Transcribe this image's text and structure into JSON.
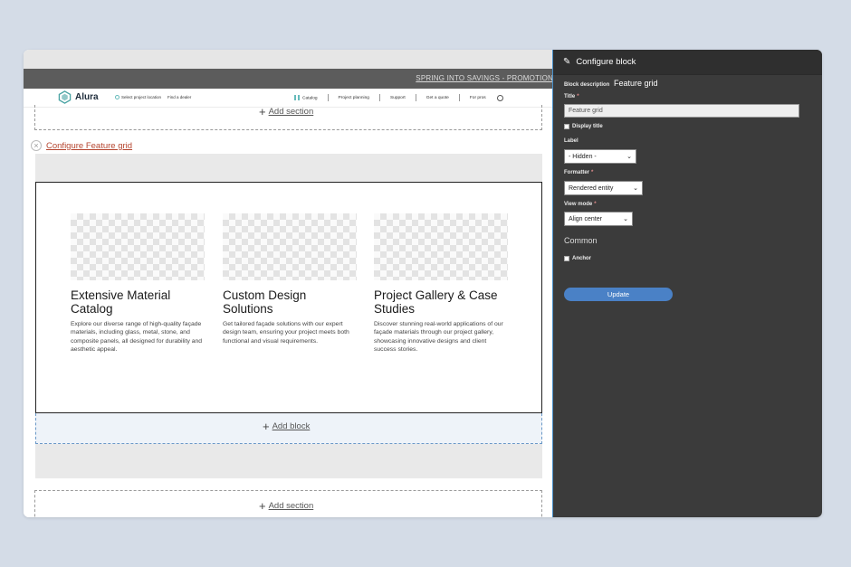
{
  "site": {
    "promo": "SPRING INTO SAVINGS - PROMOTION",
    "brand": "Alura",
    "location_link": "Select project location",
    "dealer_link": "Find a dealer",
    "nav": [
      "Catalog",
      "Project planning",
      "Support",
      "Get a quote",
      "For pros"
    ]
  },
  "builder": {
    "add_section_top": "Add section",
    "configure_link": "Configure Feature grid",
    "add_block": "Add block",
    "add_section_bottom": "Add section"
  },
  "features": [
    {
      "title": "Extensive Material Catalog",
      "desc": "Explore our diverse range of high-quality façade materials, including glass, metal, stone, and composite panels, all designed for durability and aesthetic appeal."
    },
    {
      "title": "Custom Design Solutions",
      "desc": "Get tailored façade solutions with our expert design team, ensuring your project meets both functional and visual requirements."
    },
    {
      "title": "Project Gallery & Case Studies",
      "desc": "Discover stunning real-world applications of our façade materials through our project gallery, showcasing innovative designs and client success stories."
    }
  ],
  "panel": {
    "title": "Configure block",
    "block_desc_label": "Block description",
    "block_desc_value": "Feature grid",
    "title_label": "Title",
    "title_value": "Feature grid",
    "display_title": "Display title",
    "label_label": "Label",
    "label_value": "- Hidden -",
    "formatter_label": "Formatter",
    "formatter_value": "Rendered entity",
    "view_mode_label": "View mode",
    "view_mode_value": "Align center",
    "common": "Common",
    "anchor": "Anchor",
    "update": "Update"
  },
  "colors": {
    "background": "#d4dce7",
    "panel": "#3b3b3b",
    "accent": "#4a81c6",
    "configure_link": "#b5452f"
  }
}
